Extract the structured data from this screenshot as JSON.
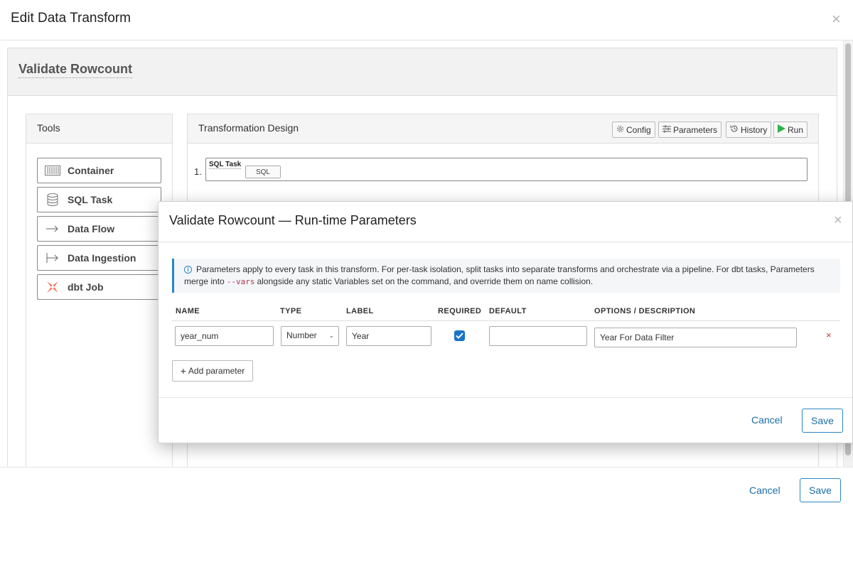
{
  "outer": {
    "title": "Edit Data Transform",
    "close_glyph": "×",
    "transform_name": "Validate Rowcount",
    "tools_title": "Tools",
    "tools": [
      {
        "label": "Container",
        "icon": "container-icon"
      },
      {
        "label": "SQL Task",
        "icon": "database-icon"
      },
      {
        "label": "Data Flow",
        "icon": "arrow-right-icon"
      },
      {
        "label": "Data Ingestion",
        "icon": "ingest-arrow-icon"
      },
      {
        "label": "dbt Job",
        "icon": "dbt-logo-icon"
      }
    ],
    "design_title": "Transformation Design",
    "toolbar": {
      "config": "Config",
      "parameters": "Parameters",
      "history": "History",
      "run": "Run"
    },
    "task": {
      "number": "1.",
      "title": "SQL Task",
      "badge": "SQL"
    },
    "footer": {
      "cancel": "Cancel",
      "save": "Save"
    }
  },
  "inner": {
    "title": "Validate Rowcount — Run-time Parameters",
    "close_glyph": "×",
    "info": {
      "text_before": "Parameters apply to every task in this transform. For per-task isolation, split tasks into separate transforms and orchestrate via a pipeline. For dbt tasks, Parameters merge into",
      "code": "--vars",
      "text_after": "alongside any static Variables set on the command, and override them on name collision."
    },
    "columns": {
      "name": "NAME",
      "type": "TYPE",
      "label": "LABEL",
      "required": "REQUIRED",
      "default": "DEFAULT",
      "options": "OPTIONS / DESCRIPTION"
    },
    "rows": [
      {
        "name": "year_num",
        "type": "Number",
        "label": "Year",
        "required": true,
        "default": "",
        "options": "Year For Data Filter",
        "remove": "×"
      }
    ],
    "add_parameter": "Add parameter",
    "footer": {
      "cancel": "Cancel",
      "save": "Save"
    }
  },
  "colors": {
    "accent": "#2b86c5",
    "run_green": "#2db34a",
    "remove_red": "#c0392b",
    "checkbox_blue": "#1a73c9"
  }
}
